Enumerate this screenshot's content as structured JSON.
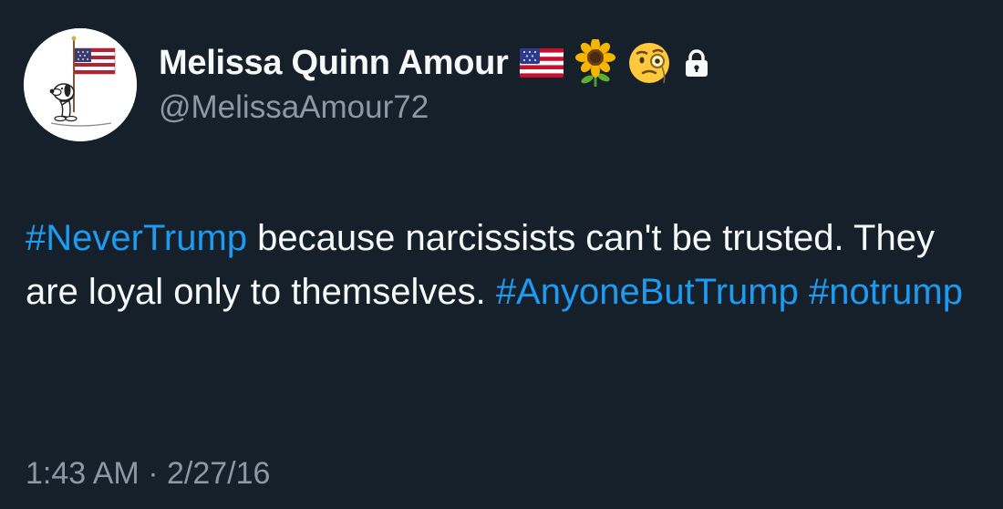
{
  "user": {
    "display_name": "Melissa Quinn Amour",
    "handle": "@MelissaAmour72",
    "name_emojis": [
      "us-flag-icon",
      "sunflower-icon",
      "face-with-monocle-icon"
    ],
    "protected_icon": "lock-icon"
  },
  "tweet": {
    "hashtag_1": "#NeverTrump",
    "text_1": " because narcissists can't be trusted. They are loyal only to themselves. ",
    "hashtag_2": "#AnyoneButTrump",
    "space": " ",
    "hashtag_3": "#notrump",
    "time": "1:43 AM",
    "separator": " · ",
    "date": "2/27/16"
  },
  "colors": {
    "background": "#15202b",
    "text": "#f7f9f9",
    "secondary": "#8b98a5",
    "link": "#1d9bf0"
  }
}
